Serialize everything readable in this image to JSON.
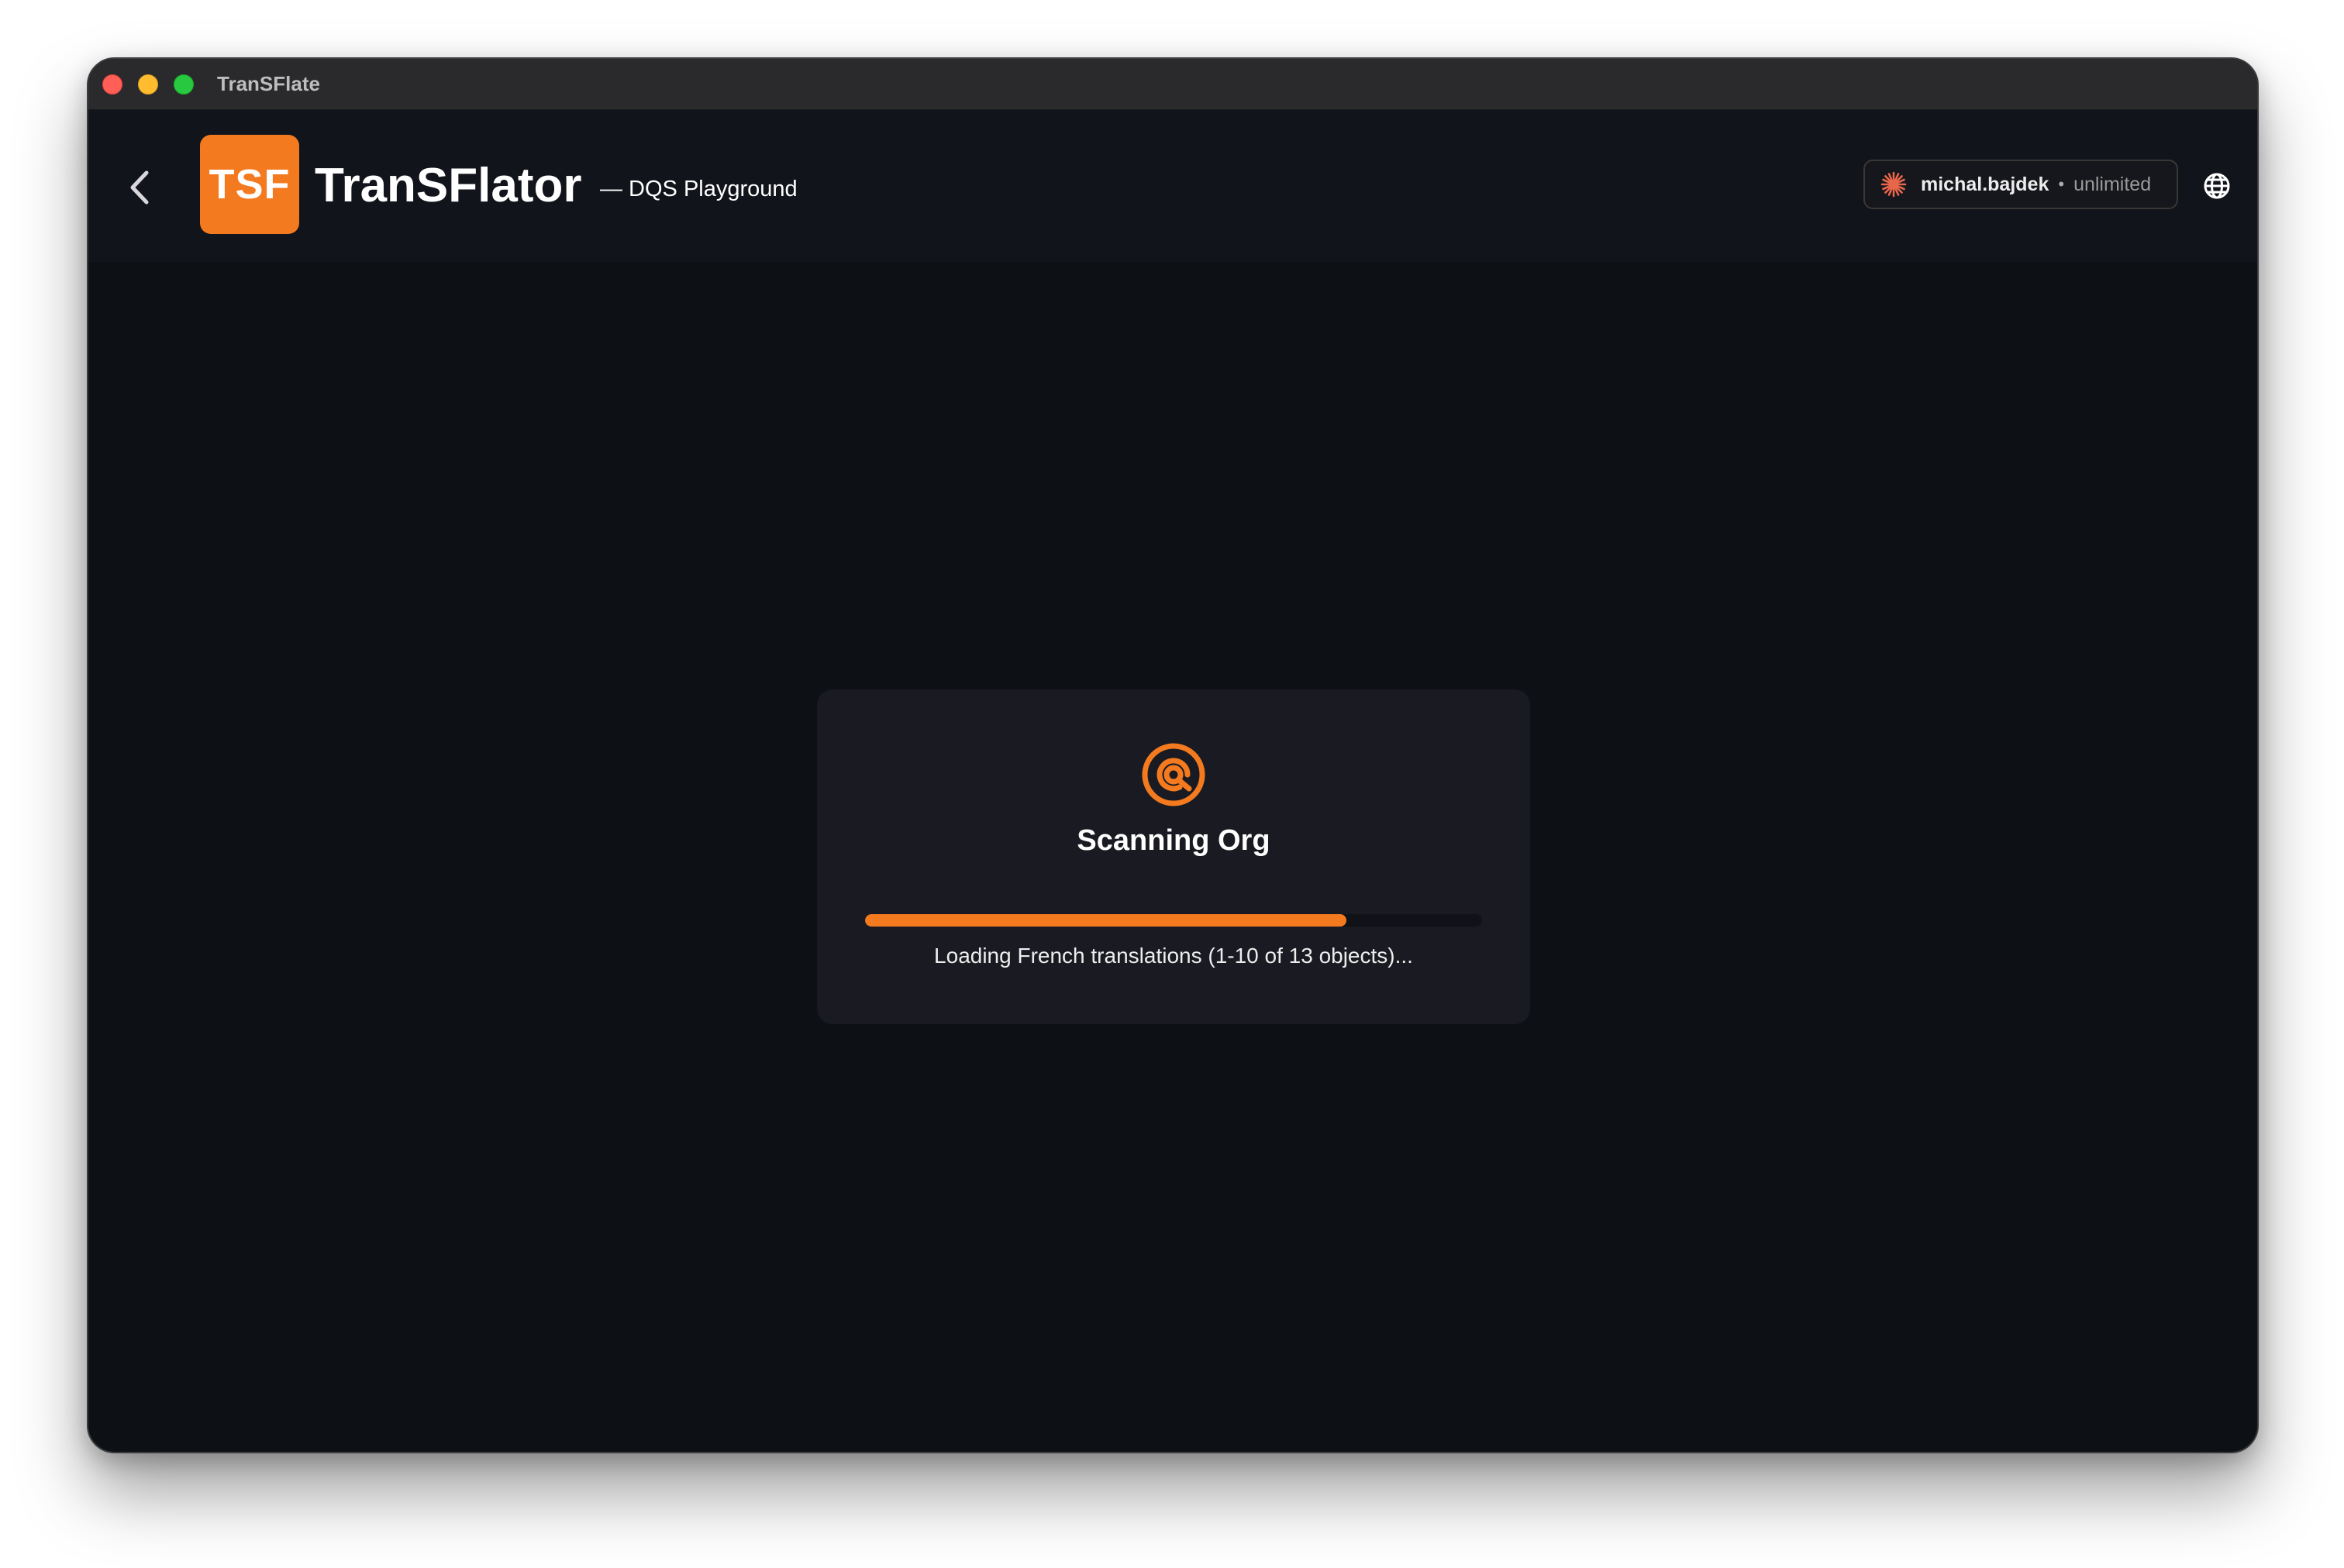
{
  "window": {
    "title": "TranSFlate"
  },
  "header": {
    "logo_text": "TSF",
    "app_name": "TranSFlator",
    "org_label": "— DQS Playground",
    "user": {
      "name": "michal.bajdek",
      "separator": "•",
      "plan": "unlimited"
    },
    "icons": {
      "back": "chevron-left-icon",
      "user": "sparkle-icon",
      "language": "globe-icon"
    }
  },
  "scan": {
    "title": "Scanning Org",
    "status": "Loading French translations (1-10 of 13 objects)...",
    "progress": 0.78,
    "icon": "scan-target-icon"
  },
  "colors": {
    "accent": "#f47a1f",
    "background": "#0d1014",
    "header_bg": "#12141b",
    "card_bg": "#1a1b22"
  }
}
